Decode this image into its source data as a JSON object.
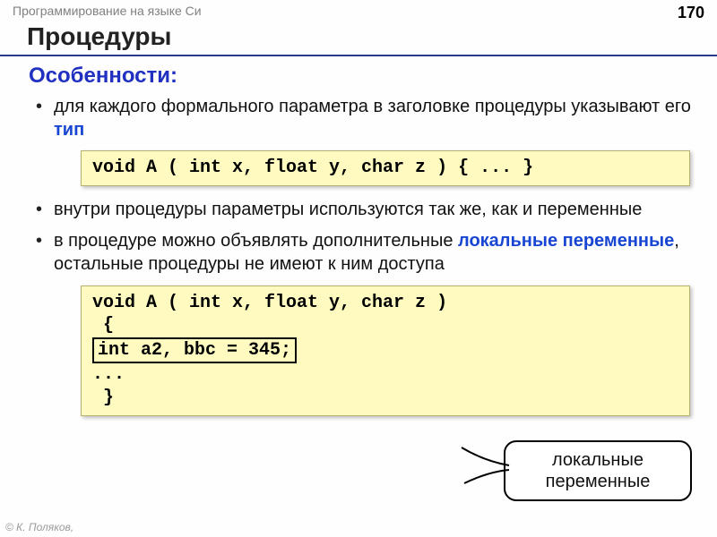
{
  "header": {
    "course": "Программирование на языке Си",
    "page": "170"
  },
  "title": "Процедуры",
  "subtitle": "Особенности:",
  "bullets": {
    "b1_pre": "для каждого формального параметра в заголовке процедуры указывают его ",
    "b1_kw": "тип",
    "b2": "внутри процедуры параметры используются так же, как и переменные",
    "b3_pre": "в процедуре можно объявлять дополнительные ",
    "b3_kw": "локальные переменные",
    "b3_post": ", остальные процедуры не имеют к ним доступа"
  },
  "code1": "void A ( int x, float y, char z ) { ... }",
  "code2_l1": "void A ( int x, float y, char z )",
  "code2_l2": " {",
  "code2_boxed": "int a2, bbc = 345;",
  "code2_l4": "...",
  "code2_l5": " }",
  "callout": "локальные переменные",
  "copyright": "© К. Поляков, "
}
